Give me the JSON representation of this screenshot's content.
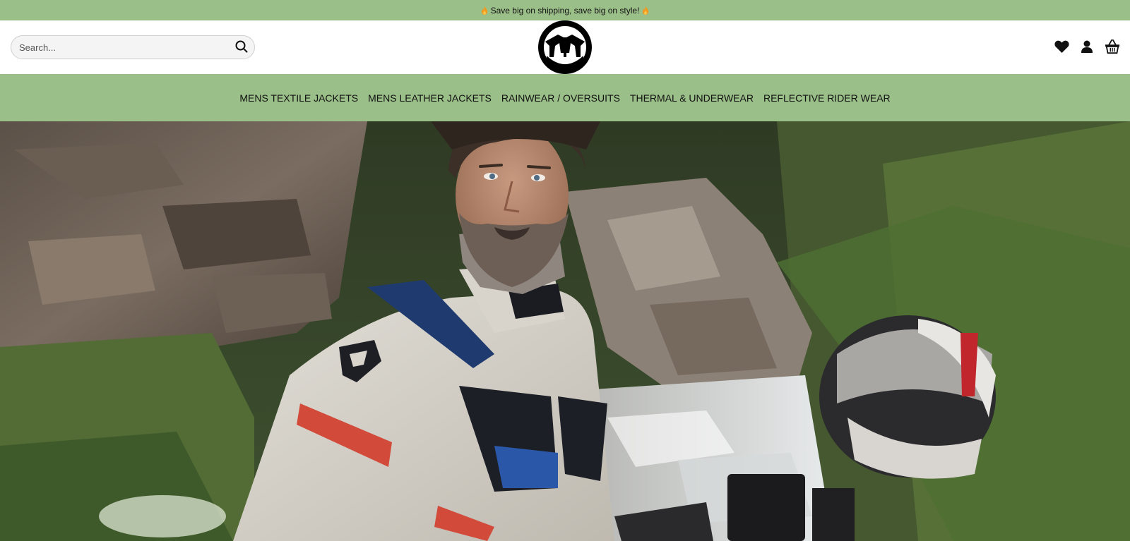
{
  "announcement": {
    "text": "Save big on shipping, save big on style!",
    "icon_left": "flame-icon",
    "icon_right": "flame-icon"
  },
  "header": {
    "search": {
      "placeholder": "Search...",
      "value": "",
      "icon": "search-icon"
    },
    "logo_icon": "brand-logo",
    "icons": [
      "heart-icon",
      "user-icon",
      "basket-icon"
    ]
  },
  "nav": {
    "items": [
      {
        "label": "MENS TEXTILE JACKETS"
      },
      {
        "label": "MENS LEATHER JACKETS"
      },
      {
        "label": "RAINWEAR / OVERSUITS"
      },
      {
        "label": "THERMAL & UNDERWEAR"
      },
      {
        "label": "REFLECTIVE RIDER WEAR"
      }
    ]
  },
  "hero": {
    "image": "hero-photo"
  },
  "colors": {
    "accent_green": "#9bbf88",
    "header_bg": "#ffffff",
    "text": "#111111"
  }
}
